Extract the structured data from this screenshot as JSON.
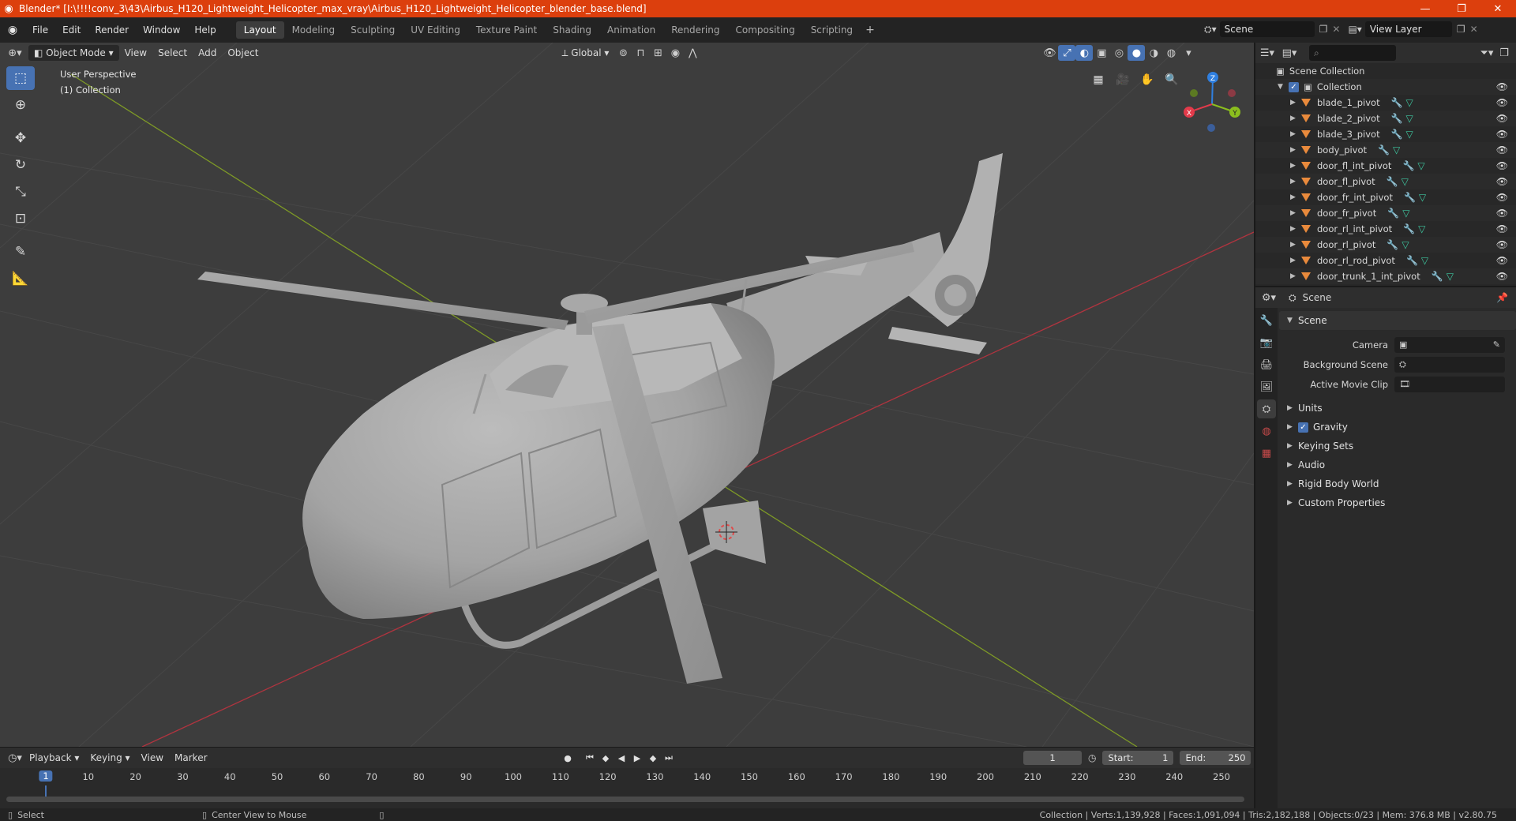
{
  "window": {
    "title": "Blender* [I:\\!!!!conv_3\\43\\Airbus_H120_Lightweight_Helicopter_max_vray\\Airbus_H120_Lightweight_Helicopter_blender_base.blend]",
    "minimize": "—",
    "maximize": "❐",
    "close": "✕"
  },
  "menu": [
    "File",
    "Edit",
    "Render",
    "Window",
    "Help"
  ],
  "workspaces": [
    "Layout",
    "Modeling",
    "Sculpting",
    "UV Editing",
    "Texture Paint",
    "Shading",
    "Animation",
    "Rendering",
    "Compositing",
    "Scripting"
  ],
  "active_workspace": "Layout",
  "scene_name": "Scene",
  "view_layer": "View Layer",
  "viewport": {
    "mode": "Object Mode",
    "menus": [
      "View",
      "Select",
      "Add",
      "Object"
    ],
    "orientation": "Global",
    "perspective_label": "User Perspective",
    "collection_label": "(1) Collection",
    "gizmo": {
      "x": "X",
      "y": "Y",
      "z": "Z"
    }
  },
  "outliner": {
    "root": "Scene Collection",
    "collection": "Collection",
    "objects": [
      "blade_1_pivot",
      "blade_2_pivot",
      "blade_3_pivot",
      "body_pivot",
      "door_fl_int_pivot",
      "door_fl_pivot",
      "door_fr_int_pivot",
      "door_fr_pivot",
      "door_rl_int_pivot",
      "door_rl_pivot",
      "door_rl_rod_pivot",
      "door_trunk_1_int_pivot"
    ]
  },
  "properties": {
    "context": "Scene",
    "panel": "Scene",
    "fields": [
      {
        "label": "Camera",
        "value": ""
      },
      {
        "label": "Background Scene",
        "value": ""
      },
      {
        "label": "Active Movie Clip",
        "value": ""
      }
    ],
    "subpanels": [
      "Units",
      "Gravity",
      "Keying Sets",
      "Audio",
      "Rigid Body World",
      "Custom Properties"
    ],
    "gravity_enabled": true
  },
  "timeline": {
    "menus": [
      "Playback",
      "Keying",
      "View",
      "Marker"
    ],
    "current_frame": "1",
    "start_label": "Start:",
    "start": "1",
    "end_label": "End:",
    "end": "250",
    "ticks": [
      "1",
      "10",
      "20",
      "30",
      "40",
      "50",
      "60",
      "70",
      "80",
      "90",
      "100",
      "110",
      "120",
      "130",
      "140",
      "150",
      "160",
      "170",
      "180",
      "190",
      "200",
      "210",
      "220",
      "230",
      "240",
      "250"
    ]
  },
  "status": {
    "left_action": "Select",
    "middle_action": "Center View to Mouse",
    "stats": "Collection | Verts:1,139,928 | Faces:1,091,094 | Tris:2,182,188 | Objects:0/23 | Mem: 376.8 MB | v2.80.75"
  },
  "colors": {
    "titlebar": "#dc3f0d",
    "accent": "#4772b3",
    "viewport_bg": "#3d3d3d",
    "x_axis": "#e23a4a",
    "y_axis": "#8bbe1e",
    "z_axis": "#2f7fe0"
  }
}
